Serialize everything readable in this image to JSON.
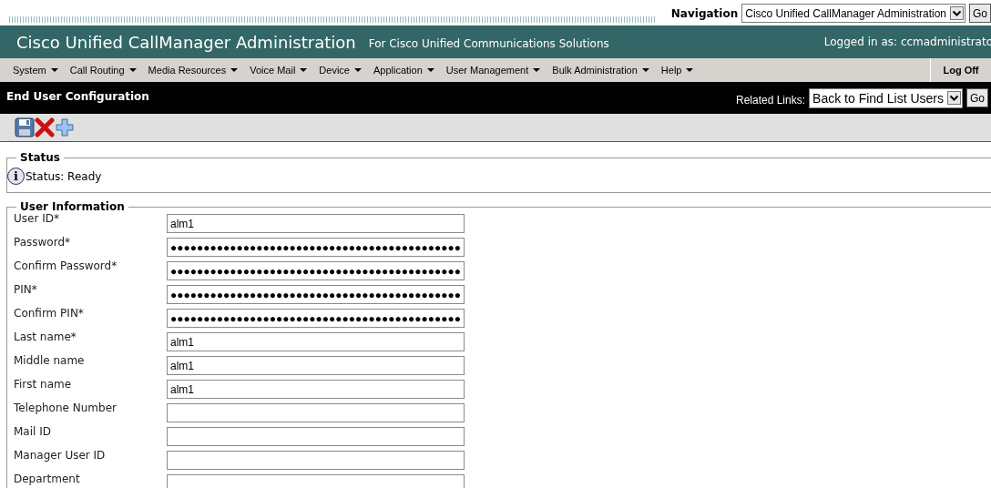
{
  "top_bar": {
    "navigation_label": "Navigation",
    "navigation_select": "Cisco Unified CallManager Administration",
    "go_button": "Go"
  },
  "header": {
    "title": "Cisco Unified CallManager Administration",
    "subtitle": "For Cisco Unified Communications Solutions",
    "login_text": "Logged in as: ccmadministrato"
  },
  "menu": [
    {
      "label": "System"
    },
    {
      "label": "Call Routing"
    },
    {
      "label": "Media Resources"
    },
    {
      "label": "Voice Mail"
    },
    {
      "label": "Device"
    },
    {
      "label": "Application"
    },
    {
      "label": "User Management"
    },
    {
      "label": "Bulk Administration"
    },
    {
      "label": "Help"
    }
  ],
  "log_off": "Log Off",
  "page_bar": {
    "title": "End User Configuration",
    "related_links_label": "Related Links:",
    "related_links_select": "Back to Find List Users",
    "go_button": "Go"
  },
  "toolbar": [
    {
      "kind": "save"
    },
    {
      "kind": "delete"
    },
    {
      "kind": "add"
    }
  ],
  "status": {
    "legend": "Status",
    "icon": "i",
    "text": "Status: Ready"
  },
  "user_information": {
    "legend": "User Information",
    "fields": [
      {
        "label": "User ID*",
        "value": "alm1"
      },
      {
        "label": "Password*",
        "value": "●●●●●●●●●●●●●●●●●●●●●●●●●●●●●●●●●●●●●●●●●●●●"
      },
      {
        "label": "Confirm Password*",
        "value": "●●●●●●●●●●●●●●●●●●●●●●●●●●●●●●●●●●●●●●●●●●●●"
      },
      {
        "label": "PIN*",
        "value": "●●●●●●●●●●●●●●●●●●●●●●●●●●●●●●●●●●●●●●●●●●●●"
      },
      {
        "label": "Confirm PIN*",
        "value": "●●●●●●●●●●●●●●●●●●●●●●●●●●●●●●●●●●●●●●●●●●●●"
      },
      {
        "label": "Last name*",
        "value": "alm1"
      },
      {
        "label": "Middle name",
        "value": "alm1"
      },
      {
        "label": "First name",
        "value": "alm1"
      },
      {
        "label": "Telephone Number"
      },
      {
        "label": "Mail ID"
      },
      {
        "label": "Manager User ID"
      },
      {
        "label": "Department"
      }
    ]
  }
}
